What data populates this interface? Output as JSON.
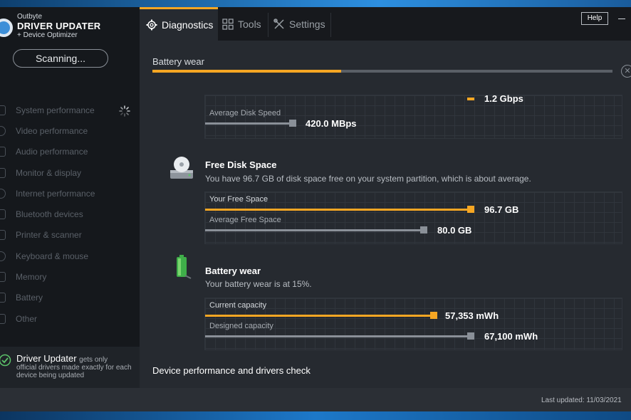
{
  "brand": {
    "line1": "Outbyte",
    "line2": "DRIVER UPDATER",
    "line3": "+ Device Optimizer"
  },
  "sidebar": {
    "scan_button": "Scanning...",
    "items": [
      {
        "label": "System performance",
        "icon": "monitor-icon"
      },
      {
        "label": "Video performance",
        "icon": "video-icon"
      },
      {
        "label": "Audio performance",
        "icon": "speaker-icon"
      },
      {
        "label": "Monitor & display",
        "icon": "display-icon"
      },
      {
        "label": "Internet performance",
        "icon": "globe-icon"
      },
      {
        "label": "Bluetooth devices",
        "icon": "bluetooth-icon"
      },
      {
        "label": "Printer & scanner",
        "icon": "printer-icon"
      },
      {
        "label": "Keyboard & mouse",
        "icon": "keyboard-icon"
      },
      {
        "label": "Memory",
        "icon": "memory-icon"
      },
      {
        "label": "Battery",
        "icon": "battery-icon"
      },
      {
        "label": "Other",
        "icon": "other-icon"
      }
    ],
    "promo": {
      "title": "Driver Updater",
      "title_suffix": "gets only",
      "text": "official drivers made exactly for each device being updated"
    }
  },
  "topbar": {
    "tabs": [
      {
        "label": "Diagnostics",
        "icon": "gear-icon",
        "active": true
      },
      {
        "label": "Tools",
        "icon": "grid-icon",
        "active": false
      },
      {
        "label": "Settings",
        "icon": "wrench-icon",
        "active": false
      }
    ],
    "help_label": "Help"
  },
  "progress": {
    "label": "Battery wear",
    "percent": 41
  },
  "sections": {
    "disk_speed": {
      "partial_value": "1.2 Gbps",
      "avg_label": "Average Disk Speed",
      "avg_value": "420.0 MBps"
    },
    "free_space": {
      "icon": "disk-drive-icon",
      "title": "Free Disk Space",
      "description": "You have 96.7 GB of disk space free on your system partition, which is about average.",
      "bars": [
        {
          "label": "Your Free Space",
          "value": "96.7 GB",
          "fraction": 0.64,
          "color": "#f5a623"
        },
        {
          "label": "Average Free Space",
          "value": "80.0 GB",
          "fraction": 0.53,
          "color": "#8a9098"
        }
      ]
    },
    "battery": {
      "icon": "battery-icon",
      "title": "Battery wear",
      "description": "Your battery wear is at 15%.",
      "bars": [
        {
          "label": "Current capacity",
          "value": "57,353 mWh",
          "fraction": 0.55,
          "color": "#f5a623"
        },
        {
          "label": "Designed capacity",
          "value": "67,100 mWh",
          "fraction": 0.64,
          "color": "#8a9098"
        }
      ]
    }
  },
  "footer_title": "Device performance and drivers check",
  "status": {
    "last_updated": "Last updated: 11/03/2021"
  },
  "colors": {
    "accent": "#f5a623",
    "gray_bar": "#8a9098",
    "background": "#262a30",
    "sidebar": "#15181c"
  }
}
